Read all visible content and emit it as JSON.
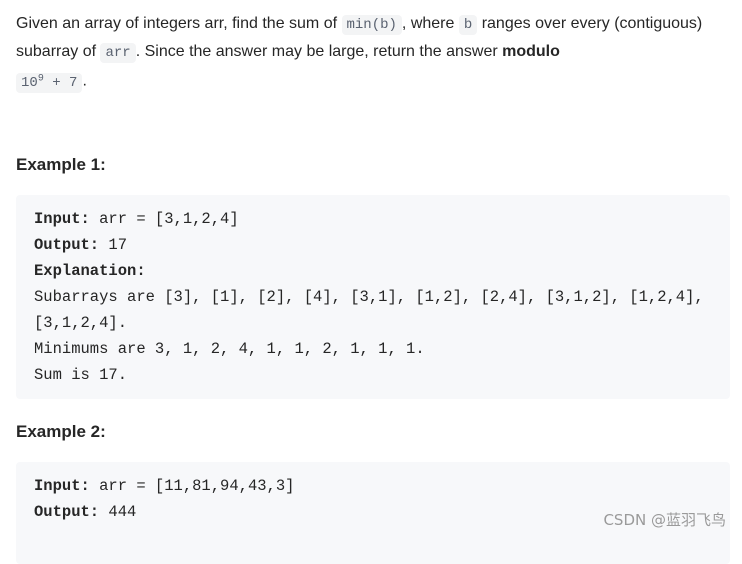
{
  "intro": {
    "t1": "Given an array of integers arr, find the sum of ",
    "c1": "min(b)",
    "t2": ", where ",
    "c2": "b",
    "t3": " ranges over every (contiguous) subarray of ",
    "c3": "arr",
    "t4": ". Since the answer may be large, return the answer ",
    "bold": "modulo",
    "c4a": "10",
    "c4sup": "9",
    "c4b": " + 7",
    "t5": "."
  },
  "ex1": {
    "title": "Example 1:",
    "input_label": "Input:",
    "input": " arr = [3,1,2,4]",
    "output_label": "Output:",
    "output": " 17",
    "expl_label": "Explanation:",
    "expl": "Subarrays are [3], [1], [2], [4], [3,1], [1,2], [2,4], [3,1,2], [1,2,4], [3,1,2,4].\nMinimums are 3, 1, 2, 4, 1, 1, 2, 1, 1, 1.\nSum is 17."
  },
  "ex2": {
    "title": "Example 2:",
    "input_label": "Input:",
    "input": " arr = [11,81,94,43,3]",
    "output_label": "Output:",
    "output": " 444"
  },
  "watermark": "CSDN @蓝羽飞鸟"
}
